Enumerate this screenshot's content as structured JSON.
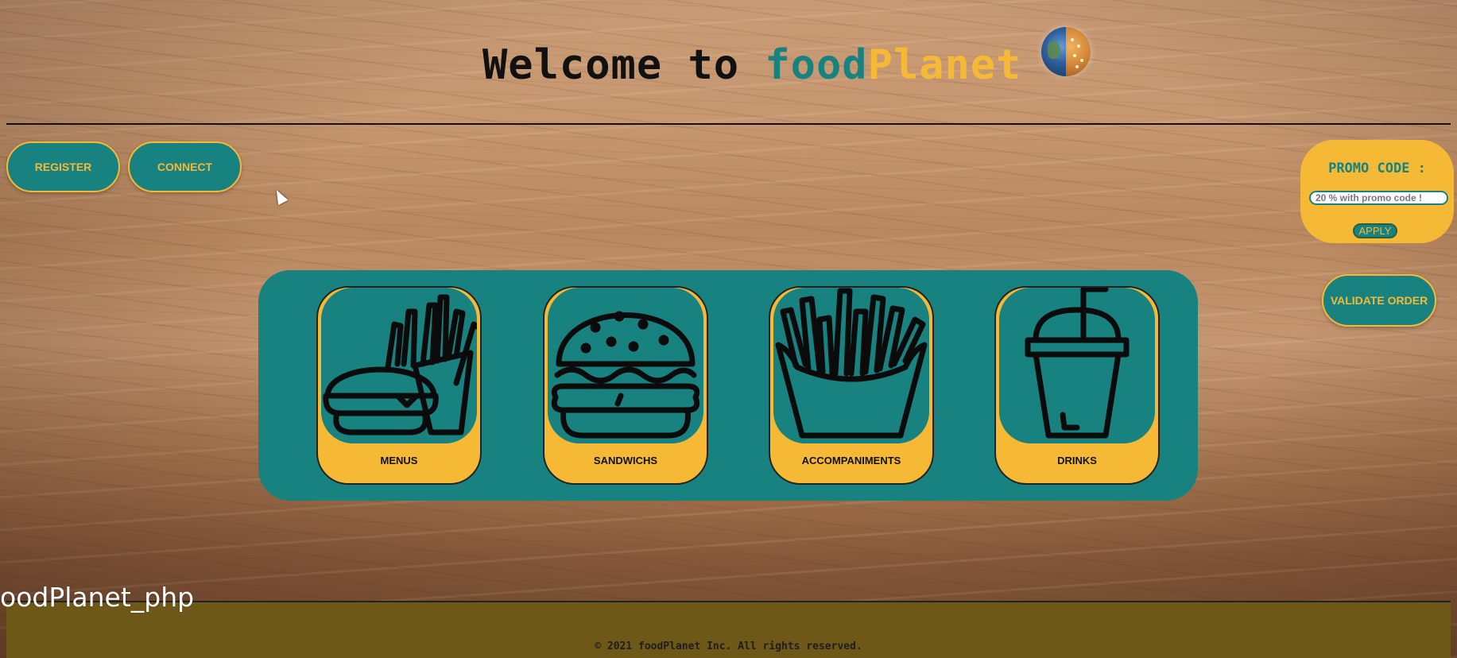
{
  "header": {
    "title_prefix": "Welcome to ",
    "brand_food": "food",
    "brand_planet": "Planet",
    "logo_icon": "globe-icon"
  },
  "nav": {
    "register_label": "REGISTER",
    "connect_label": "CONNECT"
  },
  "promo": {
    "title": "PROMO CODE :",
    "input_placeholder": "20 % with promo code !",
    "input_value": "",
    "apply_label": "APPLY"
  },
  "order": {
    "validate_label": "VALIDATE ORDER"
  },
  "categories": [
    {
      "label": "MENUS",
      "icon": "burger-fries-icon"
    },
    {
      "label": "SANDWICHS",
      "icon": "burger-icon"
    },
    {
      "label": "ACCOMPANIMENTS",
      "icon": "fries-icon"
    },
    {
      "label": "DRINKS",
      "icon": "drink-cup-icon"
    }
  ],
  "footer": {
    "copyright": "© 2021 foodPlanet Inc. All rights reserved."
  },
  "overlay": {
    "window_label": "oodPlanet_php"
  },
  "colors": {
    "teal": "#17827f",
    "gold": "#f6b936",
    "footer_bg": "#6e5817",
    "text_dark": "#111111"
  }
}
